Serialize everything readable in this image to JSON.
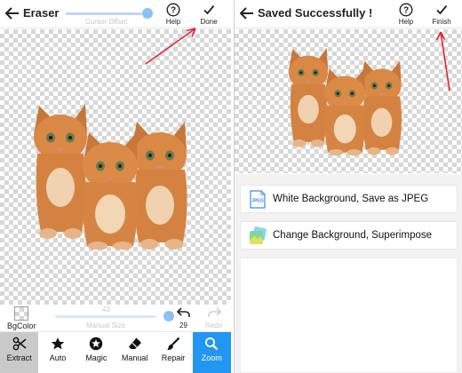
{
  "left_screen": {
    "title": "Eraser",
    "offset_slider": {
      "caption": "Cursor Offset",
      "level": 0.9
    },
    "help_label": "Help",
    "done_label": "Done",
    "bgcolor_label": "BgColor",
    "manual_size": {
      "value": "43",
      "label": "Manual Size",
      "level": 0.9
    },
    "undo_count": "29",
    "redo_label": "Redo",
    "tools": [
      {
        "label": "Extract",
        "icon": "scissors-icon",
        "state": "selected"
      },
      {
        "label": "Auto",
        "icon": "star-icon",
        "state": "normal"
      },
      {
        "label": "Magic",
        "icon": "magic-star-icon",
        "state": "normal"
      },
      {
        "label": "Manual",
        "icon": "eraser-icon",
        "state": "normal"
      },
      {
        "label": "Repair",
        "icon": "brush-icon",
        "state": "normal"
      },
      {
        "label": "Zoom",
        "icon": "magnifier-icon",
        "state": "active"
      }
    ]
  },
  "right_screen": {
    "title": "Saved Successfully !",
    "help_label": "Help",
    "finish_label": "Finish",
    "options": [
      {
        "icon_text": "JPEG",
        "label": "White Background, Save as JPEG"
      },
      {
        "label": "Change Background, Superimpose"
      }
    ]
  },
  "colors": {
    "accent_blue": "#2196f3",
    "slider_blue": "#8ec0f7",
    "annotation_red": "#e0242a",
    "checker_gray": "#d7d7d7"
  }
}
